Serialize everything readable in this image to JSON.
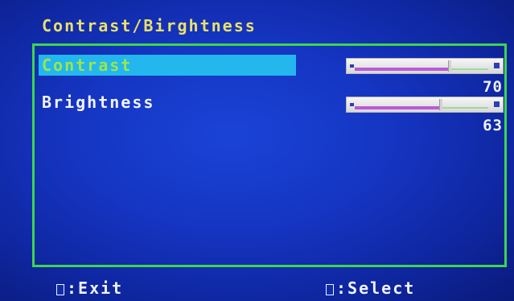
{
  "osd": {
    "title": "Contrast/Birghtness"
  },
  "settings": [
    {
      "label": "Contrast",
      "value": "70",
      "level": 0.7,
      "selected": true
    },
    {
      "label": "Brightness",
      "value": "63",
      "level": 0.63,
      "selected": false
    }
  ],
  "footer": {
    "exit_label": "Exit",
    "select_label": "Select"
  },
  "colors": {
    "background": "#1535c2",
    "title": "#e9e06a",
    "border": "#3ed64a",
    "selection": "#23b7ee",
    "slider_fill": "#b95bd6"
  }
}
